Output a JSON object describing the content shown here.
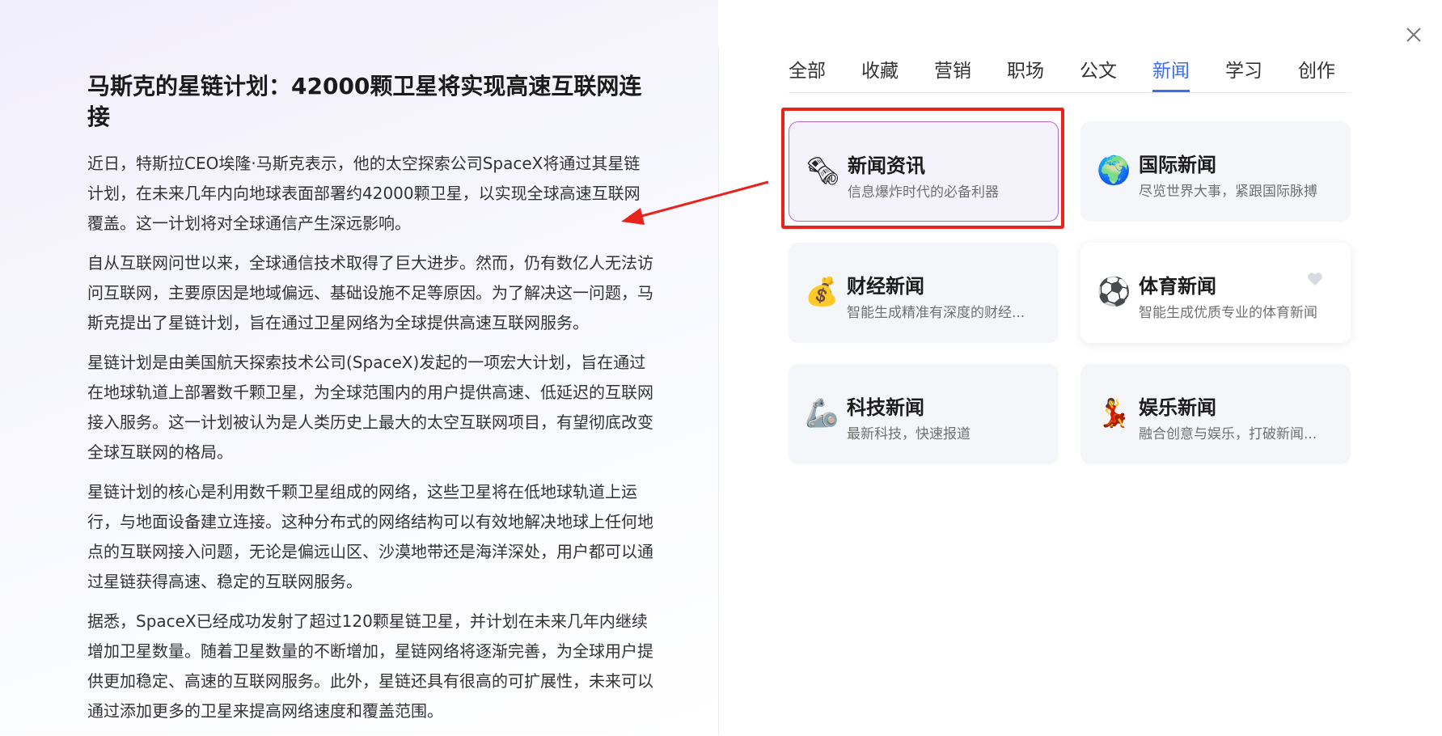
{
  "article": {
    "title": "马斯克的星链计划：42000颗卫星将实现高速互联网连接",
    "paragraphs": [
      "近日，特斯拉CEO埃隆·马斯克表示，他的太空探索公司SpaceX将通过其星链计划，在未来几年内向地球表面部署约42000颗卫星，以实现全球高速互联网覆盖。这一计划将对全球通信产生深远影响。",
      "自从互联网问世以来，全球通信技术取得了巨大进步。然而，仍有数亿人无法访问互联网，主要原因是地域偏远、基础设施不足等原因。为了解决这一问题，马斯克提出了星链计划，旨在通过卫星网络为全球提供高速互联网服务。",
      "星链计划是由美国航天探索技术公司(SpaceX)发起的一项宏大计划，旨在通过在地球轨道上部署数千颗卫星，为全球范围内的用户提供高速、低延迟的互联网接入服务。这一计划被认为是人类历史上最大的太空互联网项目，有望彻底改变全球互联网的格局。",
      "星链计划的核心是利用数千颗卫星组成的网络，这些卫星将在低地球轨道上运行，与地面设备建立连接。这种分布式的网络结构可以有效地解决地球上任何地点的互联网接入问题，无论是偏远山区、沙漠地带还是海洋深处，用户都可以通过星链获得高速、稳定的互联网服务。",
      "据悉，SpaceX已经成功发射了超过120颗星链卫星，并计划在未来几年内继续增加卫星数量。随着卫星数量的不断增加，星链网络将逐渐完善，为全球用户提供更加稳定、高速的互联网服务。此外，星链还具有很高的可扩展性，未来可以通过添加更多的卫星来提高网络速度和覆盖范围。"
    ]
  },
  "tabs": [
    {
      "label": "全部"
    },
    {
      "label": "收藏"
    },
    {
      "label": "营销"
    },
    {
      "label": "职场"
    },
    {
      "label": "公文"
    },
    {
      "label": "新闻",
      "active": true
    },
    {
      "label": "学习"
    },
    {
      "label": "创作"
    }
  ],
  "cards": [
    {
      "title": "新闻资讯",
      "desc": "信息爆炸时代的必备利器",
      "icon": "newspaper-icon",
      "glyph": "🗞",
      "state": "selected"
    },
    {
      "title": "国际新闻",
      "desc": "尽览世界大事，紧跟国际脉搏",
      "icon": "globe-icon",
      "glyph": "🌍"
    },
    {
      "title": "财经新闻",
      "desc": "智能生成精准有深度的财经...",
      "icon": "money-bag-icon",
      "glyph": "💰"
    },
    {
      "title": "体育新闻",
      "desc": "智能生成优质专业的体育新闻",
      "icon": "soccer-ball-icon",
      "glyph": "⚽",
      "state": "hover",
      "favorite_icon": "heart-icon"
    },
    {
      "title": "科技新闻",
      "desc": "最新科技，快速报道",
      "icon": "mechanical-arm-icon",
      "glyph": "🦾"
    },
    {
      "title": "娱乐新闻",
      "desc": "融合创意与娱乐，打破新闻...",
      "icon": "dancer-icon",
      "glyph": "💃"
    }
  ],
  "colors": {
    "accent": "#3e6bf0",
    "highlight_box": "#e8231c",
    "selected_border": "#b764d8",
    "card_bg": "#f5f6fa"
  },
  "icons": {
    "close": "close-icon",
    "annotation_arrow": "arrow-icon"
  }
}
